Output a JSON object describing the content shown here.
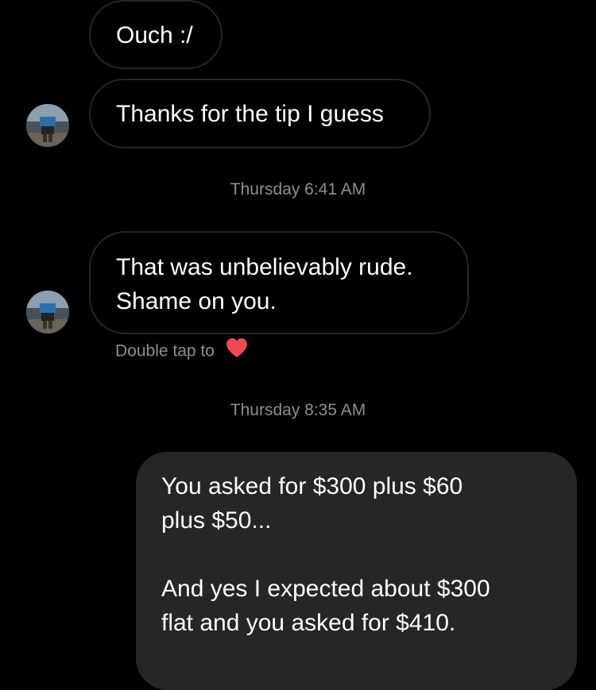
{
  "conversation": {
    "messages_incoming_1": {
      "msg1": "Ouch :/",
      "msg2": "Thanks for the tip I guess"
    },
    "timestamp_1": "Thursday 6:41 AM",
    "incoming_2": {
      "line1": "That was unbelievably rude.",
      "line2": "Shame on you."
    },
    "double_tap_hint": "Double tap to",
    "timestamp_2": "Thursday 8:35 AM",
    "outgoing": {
      "p1_line1": "You asked for $300 plus $60",
      "p1_line2": "plus $50...",
      "p2_line1": "And yes I expected about $300",
      "p2_line2": "flat and you asked for $410."
    }
  },
  "colors": {
    "background": "#000000",
    "incoming_border": "#262626",
    "outgoing_bubble": "#262626",
    "timestamp_text": "#8e8e8e",
    "heart": "#ed4956"
  },
  "icons": {
    "avatar": "avatar-icon",
    "heart": "heart-icon"
  }
}
